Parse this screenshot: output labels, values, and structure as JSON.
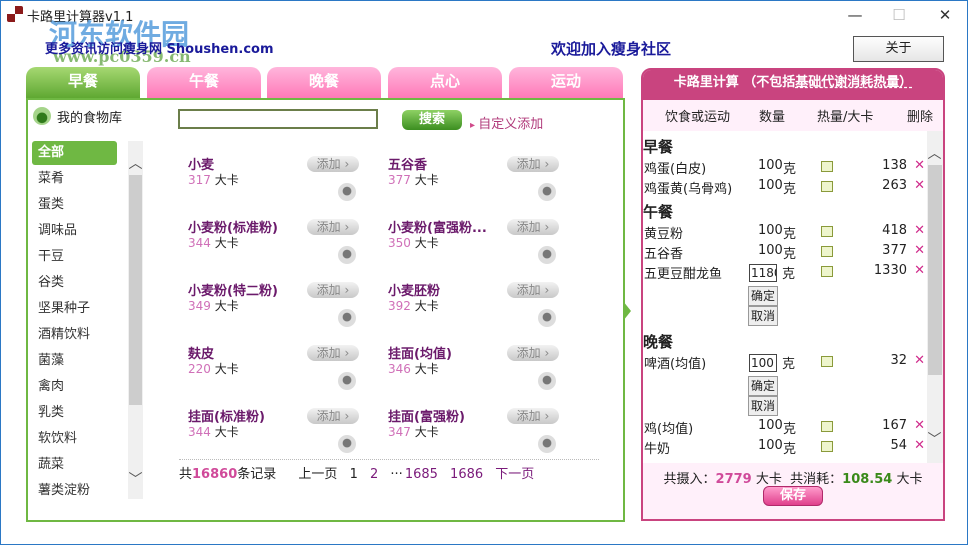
{
  "window": {
    "title": "卡路里计算器v1.1",
    "minimize": "—",
    "maximize": "☐",
    "close": "✕"
  },
  "watermark": {
    "cn": "河东软件园",
    "url": "www.pc0359.cn"
  },
  "header": {
    "more": "更多资讯访问瘦身网 Shoushen.com",
    "welcome": "欢迎加入瘦身社区",
    "about": "关于"
  },
  "tabs": [
    "早餐",
    "午餐",
    "晚餐",
    "点心",
    "运动"
  ],
  "library": {
    "title": "我的食物库",
    "search_value": "",
    "search_button": "搜索",
    "custom_add": "自定义添加"
  },
  "categories": [
    "全部",
    "菜肴",
    "蛋类",
    "调味品",
    "干豆",
    "谷类",
    "坚果种子",
    "酒精饮料",
    "菌藻",
    "禽肉",
    "乳类",
    "软饮料",
    "蔬菜",
    "薯类淀粉"
  ],
  "foods": [
    {
      "name": "小麦",
      "cal": "317"
    },
    {
      "name": "五谷香",
      "cal": "377"
    },
    {
      "name": "小麦粉(标准粉)",
      "cal": "344"
    },
    {
      "name": "小麦粉(富强粉...",
      "cal": "350"
    },
    {
      "name": "小麦粉(特二粉)",
      "cal": "349"
    },
    {
      "name": "小麦胚粉",
      "cal": "392"
    },
    {
      "name": "麸皮",
      "cal": "220"
    },
    {
      "name": "挂面(均值)",
      "cal": "346"
    },
    {
      "name": "挂面(标准粉)",
      "cal": "344"
    },
    {
      "name": "挂面(富强粉)",
      "cal": "347"
    }
  ],
  "food_unit": "大卡",
  "add_label": "添加",
  "pager": {
    "prefix": "共",
    "count": "16860",
    "suffix": "条记录",
    "prev": "上一页",
    "pages": [
      "1",
      "2"
    ],
    "ellipsis": "···",
    "tail": [
      "1685",
      "1686"
    ],
    "next": "下一页"
  },
  "calc": {
    "title": "卡路里计算 （不包括",
    "title_u": "基础代谢消耗热量）",
    "cols": [
      "饮食或运动",
      "数量",
      "热量/大卡",
      "删除"
    ],
    "unit": "克",
    "confirm": "确定",
    "cancel": "取消",
    "sections": [
      {
        "name": "早餐",
        "items": [
          {
            "name": "鸡蛋(白皮)",
            "qty": "100",
            "cal": "138"
          },
          {
            "name": "鸡蛋黄(乌骨鸡)",
            "qty": "100",
            "cal": "263"
          }
        ]
      },
      {
        "name": "午餐",
        "items": [
          {
            "name": "黄豆粉",
            "qty": "100",
            "cal": "418"
          },
          {
            "name": "五谷香",
            "qty": "100",
            "cal": "377"
          },
          {
            "name": "五更豆酣龙鱼",
            "qty": "1180",
            "cal": "1330",
            "editing": true
          }
        ]
      },
      {
        "name": "晚餐",
        "items": [
          {
            "name": "啤酒(均值)",
            "qty": "100",
            "cal": "32",
            "editing": true
          },
          {
            "name": "鸡(均值)",
            "qty": "100",
            "cal": "167"
          },
          {
            "name": "牛奶",
            "qty": "100",
            "cal": "54"
          }
        ]
      }
    ],
    "intake_label": "共摄入：",
    "intake": "2779",
    "burn_label": "共消耗：",
    "burn": "108.54",
    "kcal": "大卡",
    "save": "保存"
  }
}
